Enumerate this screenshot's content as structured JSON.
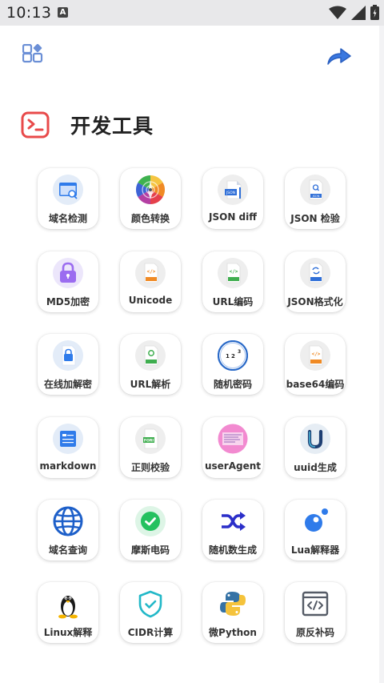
{
  "status_bar": {
    "time": "10:13",
    "notif_letter": "A"
  },
  "header": {
    "title": "开发工具"
  },
  "colors": {
    "accent": "#e84a4a",
    "share": "#3a78e0",
    "apps": "#6b8fd6"
  },
  "tools": [
    {
      "label": "域名检测",
      "icon": "domain-check-icon"
    },
    {
      "label": "颜色转换",
      "icon": "color-wheel-icon"
    },
    {
      "label": "JSON diff",
      "icon": "json-diff-icon"
    },
    {
      "label": "JSON 检验",
      "icon": "json-check-icon"
    },
    {
      "label": "MD5加密",
      "icon": "md5-lock-icon"
    },
    {
      "label": "Unicode",
      "icon": "unicode-file-icon"
    },
    {
      "label": "URL编码",
      "icon": "url-encode-file-icon"
    },
    {
      "label": "JSON格式化",
      "icon": "json-format-file-icon"
    },
    {
      "label": "在线加解密",
      "icon": "encrypt-file-icon"
    },
    {
      "label": "URL解析",
      "icon": "url-parse-file-icon"
    },
    {
      "label": "随机密码",
      "icon": "random-password-icon"
    },
    {
      "label": "base64编码",
      "icon": "base64-file-icon"
    },
    {
      "label": "markdown",
      "icon": "markdown-icon"
    },
    {
      "label": "正则校验",
      "icon": "regex-file-icon"
    },
    {
      "label": "userAgent",
      "icon": "user-agent-icon"
    },
    {
      "label": "uuid生成",
      "icon": "uuid-icon"
    },
    {
      "label": "域名查询",
      "icon": "globe-icon"
    },
    {
      "label": "摩斯电码",
      "icon": "morse-check-icon"
    },
    {
      "label": "随机数生成",
      "icon": "shuffle-icon"
    },
    {
      "label": "Lua解释器",
      "icon": "lua-icon"
    },
    {
      "label": "Linux解释",
      "icon": "linux-penguin-icon"
    },
    {
      "label": "CIDR计算",
      "icon": "cidr-shield-icon"
    },
    {
      "label": "微Python",
      "icon": "python-icon"
    },
    {
      "label": "原反补码",
      "icon": "code-window-icon"
    }
  ]
}
